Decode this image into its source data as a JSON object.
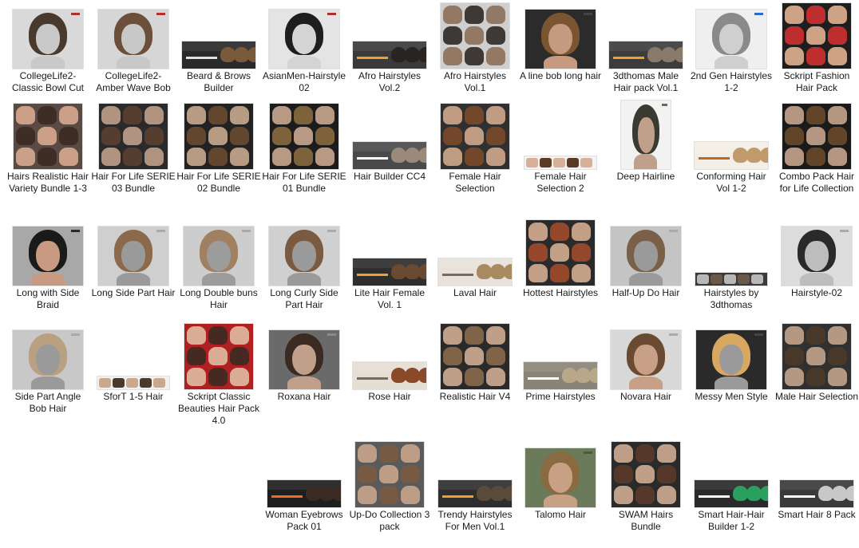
{
  "items": [
    {
      "label": "CollegeLife2-Classic Bowl Cut",
      "thumb": {
        "style": "portrait",
        "bg": "#d9d9d9",
        "hair": "#4a3a2e",
        "skin": "#c9c9c9",
        "accent": "#b03030"
      }
    },
    {
      "label": "CollegeLife2-Amber Wave Bob",
      "thumb": {
        "style": "portrait",
        "bg": "#d6d6d6",
        "hair": "#6b4f3a",
        "skin": "#c8c8c8",
        "accent": "#b03030"
      }
    },
    {
      "label": "Beard & Brows Builder",
      "thumb": {
        "style": "banner",
        "bg": "#2a2a2a",
        "hair": "#7a5a3a",
        "skin": "#b89478",
        "accent": "#e0e0e0"
      }
    },
    {
      "label": "AsianMen-Hairstyle 02",
      "thumb": {
        "style": "portrait",
        "bg": "#e4e4e4",
        "hair": "#1e1e1e",
        "skin": "#d4d4d4",
        "accent": "#b03030"
      }
    },
    {
      "label": "Afro Hairstyles Vol.2",
      "thumb": {
        "style": "banner",
        "bg": "#3a3a3a",
        "hair": "#2a2420",
        "skin": "#8a6a50",
        "accent": "#f0a030"
      }
    },
    {
      "label": "Afro Hairstyles Vol.1",
      "thumb": {
        "style": "grid",
        "bg": "#cfcfcf",
        "hair": "#2e2822",
        "skin": "#8c6e56",
        "accent": "#ffffff"
      }
    },
    {
      "label": "A line bob long hair",
      "thumb": {
        "style": "portrait",
        "bg": "#2b2b2b",
        "hair": "#7a5530",
        "skin": "#c49a80",
        "accent": "#444444"
      }
    },
    {
      "label": "3dthomas Male Hair pack Vol.1",
      "thumb": {
        "style": "banner",
        "bg": "#3c3c3c",
        "hair": "#8a7a6a",
        "skin": "#b0b0b0",
        "accent": "#f0a030"
      }
    },
    {
      "label": "2nd Gen Hairstyles 1-2",
      "thumb": {
        "style": "portrait",
        "bg": "#efefef",
        "hair": "#8a8a8a",
        "skin": "#cfcfcf",
        "accent": "#2a6ad0"
      }
    },
    {
      "label": "Sckript Fashion Hair Pack",
      "thumb": {
        "style": "grid",
        "bg": "#1e1e1e",
        "hair": "#d03030",
        "skin": "#e0b090",
        "accent": "#30a0e0"
      }
    },
    {
      "label": "Hairs Realistic Hair Variety Bundle 1-3",
      "thumb": {
        "style": "grid",
        "bg": "#5a4a44",
        "hair": "#3a2a22",
        "skin": "#d8a890",
        "accent": "#e04060"
      }
    },
    {
      "label": "Hair For Life SERIE 03 Bundle",
      "thumb": {
        "style": "grid",
        "bg": "#2a2a2a",
        "hair": "#5a4030",
        "skin": "#c0a08a",
        "accent": "#d03040"
      }
    },
    {
      "label": "Hair For Life SERIE 02 Bundle",
      "thumb": {
        "style": "grid",
        "bg": "#222222",
        "hair": "#6a4a30",
        "skin": "#c8a88e",
        "accent": "#d03040"
      }
    },
    {
      "label": "Hair For Life SERIE 01 Bundle",
      "thumb": {
        "style": "grid",
        "bg": "#1c1c1c",
        "hair": "#8a6a40",
        "skin": "#caa890",
        "accent": "#f0c040"
      }
    },
    {
      "label": "Hair Builder CC4",
      "thumb": {
        "style": "banner",
        "bg": "#4a4a4a",
        "hair": "#9a8a7a",
        "skin": "#bcbcbc",
        "accent": "#ffffff"
      }
    },
    {
      "label": "Female Hair Selection",
      "thumb": {
        "style": "grid",
        "bg": "#303030",
        "hair": "#7a4a2a",
        "skin": "#d0a88c",
        "accent": "#f0f0f0"
      }
    },
    {
      "label": "Female Hair Selection 2",
      "thumb": {
        "style": "strip",
        "bg": "#f4f4f4",
        "hair": "#5a3a22",
        "skin": "#d8b098",
        "accent": "#dddddd"
      }
    },
    {
      "label": "Deep Hairline",
      "thumb": {
        "style": "tall",
        "bg": "#f2f2f2",
        "hair": "#3a3a32",
        "skin": "#c0a08a",
        "accent": "#6a6a5a"
      }
    },
    {
      "label": "Conforming Hair Vol 1-2",
      "thumb": {
        "style": "banner",
        "bg": "#f4efe6",
        "hair": "#c09a6a",
        "skin": "#e0c4aa",
        "accent": "#b86a2a"
      }
    },
    {
      "label": "Combo Pack Hair for Life Collection",
      "thumb": {
        "style": "grid",
        "bg": "#1a1a1a",
        "hair": "#6a4a2a",
        "skin": "#c6a48c",
        "accent": "#f0c040"
      }
    },
    {
      "label": "Long with Side Braid",
      "thumb": {
        "style": "portrait",
        "bg": "#a8a8a8",
        "hair": "#1a1a1a",
        "skin": "#c89a82",
        "accent": "#2a2a2a"
      }
    },
    {
      "label": "Long Side Part Hair",
      "thumb": {
        "style": "portrait",
        "bg": "#cfcfcf",
        "hair": "#8a6a4a",
        "skin": "#9a9a9a",
        "accent": "#aaaaaa"
      }
    },
    {
      "label": "Long Double buns Hair",
      "thumb": {
        "style": "portrait",
        "bg": "#cdcdcd",
        "hair": "#a08060",
        "skin": "#9c9c9c",
        "accent": "#aaaaaa"
      }
    },
    {
      "label": "Long Curly Side Part Hair",
      "thumb": {
        "style": "portrait",
        "bg": "#d0d0d0",
        "hair": "#7a5a40",
        "skin": "#9a9a9a",
        "accent": "#aaaaaa"
      }
    },
    {
      "label": "Lite Hair Female Vol. 1",
      "thumb": {
        "style": "banner",
        "bg": "#2e2e2e",
        "hair": "#6a4a30",
        "skin": "#c8a890",
        "accent": "#f0a030"
      }
    },
    {
      "label": "Laval Hair",
      "thumb": {
        "style": "banner",
        "bg": "#e8e2da",
        "hair": "#a88a60",
        "skin": "#d8b8a0",
        "accent": "#7a6a5a"
      }
    },
    {
      "label": "Hottest Hairstyles",
      "thumb": {
        "style": "grid",
        "bg": "#2a2a2a",
        "hair": "#a04a2a",
        "skin": "#d4ac90",
        "accent": "#ffffff"
      }
    },
    {
      "label": "Half-Up Do Hair",
      "thumb": {
        "style": "portrait",
        "bg": "#c4c4c4",
        "hair": "#7a6048",
        "skin": "#9a9a9a",
        "accent": "#aaaaaa"
      }
    },
    {
      "label": "Hairstyles by 3dthomas",
      "thumb": {
        "style": "strip",
        "bg": "#3a3a3a",
        "hair": "#6a5a4a",
        "skin": "#b8b8b8",
        "accent": "#f0a030"
      }
    },
    {
      "label": "Hairstyle-02",
      "thumb": {
        "style": "portrait",
        "bg": "#dcdcdc",
        "hair": "#2a2a2a",
        "skin": "#bdbdbd",
        "accent": "#aaaaaa"
      }
    },
    {
      "label": "Side Part Angle Bob Hair",
      "thumb": {
        "style": "portrait",
        "bg": "#c8c8c8",
        "hair": "#b8a080",
        "skin": "#9a9a9a",
        "accent": "#aaaaaa"
      }
    },
    {
      "label": "SforT 1-5 Hair",
      "thumb": {
        "style": "strip",
        "bg": "#f0f0f0",
        "hair": "#4a3a2a",
        "skin": "#caa88e",
        "accent": "#3a6ad0"
      }
    },
    {
      "label": "Sckript Classic Beauties Hair Pack 4.0",
      "thumb": {
        "style": "grid",
        "bg": "#b02020",
        "hair": "#3a2a22",
        "skin": "#e0bca4",
        "accent": "#ffffff"
      }
    },
    {
      "label": "Roxana Hair",
      "thumb": {
        "style": "portrait",
        "bg": "#6a6a6a",
        "hair": "#3a2a22",
        "skin": "#c0a08a",
        "accent": "#8a8a8a"
      }
    },
    {
      "label": "Rose Hair",
      "thumb": {
        "style": "banner",
        "bg": "#e6ded4",
        "hair": "#8a4a2a",
        "skin": "#d8b49c",
        "accent": "#7a6a5a"
      }
    },
    {
      "label": "Realistic Hair V4",
      "thumb": {
        "style": "grid",
        "bg": "#2a2a2a",
        "hair": "#8a6a4a",
        "skin": "#d0ac94",
        "accent": "#ffffff"
      }
    },
    {
      "label": "Prime Hairstyles",
      "thumb": {
        "style": "banner",
        "bg": "#8a8478",
        "hair": "#b8a888",
        "skin": "#ccb8a4",
        "accent": "#ffffff"
      }
    },
    {
      "label": "Novara Hair",
      "thumb": {
        "style": "portrait",
        "bg": "#d8d8d8",
        "hair": "#6a4a30",
        "skin": "#c8a088",
        "accent": "#aaaaaa"
      }
    },
    {
      "label": "Messy Men Style",
      "thumb": {
        "style": "portrait",
        "bg": "#2a2a2a",
        "hair": "#d8a860",
        "skin": "#9a9a9a",
        "accent": "#444444"
      }
    },
    {
      "label": "Male Hair Selection",
      "thumb": {
        "style": "grid",
        "bg": "#303030",
        "hair": "#4a3a2a",
        "skin": "#c4a48c",
        "accent": "#ffffff"
      }
    },
    {
      "label": "Woman Eyebrows Pack 01",
      "thumb": {
        "style": "banner",
        "bg": "#1e1e1e",
        "hair": "#3a2a22",
        "skin": "#d8b49c",
        "accent": "#f06a20"
      }
    },
    {
      "label": "Up-Do Collection 3 pack",
      "thumb": {
        "style": "grid",
        "bg": "#5a5a5a",
        "hair": "#7a5a40",
        "skin": "#c8a48a",
        "accent": "#f0a030"
      }
    },
    {
      "label": "Trendy Hairstyles For Men Vol.1",
      "thumb": {
        "style": "banner",
        "bg": "#2e2e2e",
        "hair": "#5a4a3a",
        "skin": "#b8b8b8",
        "accent": "#f0a030"
      }
    },
    {
      "label": "Talomo Hair",
      "thumb": {
        "style": "portrait",
        "bg": "#6a7a5a",
        "hair": "#8a6a40",
        "skin": "#c8a084",
        "accent": "#4a5a3a"
      }
    },
    {
      "label": "SWAM Hairs Bundle",
      "thumb": {
        "style": "grid",
        "bg": "#2a2a2a",
        "hair": "#5a3a2a",
        "skin": "#d0ac94",
        "accent": "#ffffff"
      }
    },
    {
      "label": "Smart Hair-Hair Builder 1-2",
      "thumb": {
        "style": "banner",
        "bg": "#2a2a2a",
        "hair": "#2aa060",
        "skin": "#d4b098",
        "accent": "#ffffff"
      }
    },
    {
      "label": "Smart Hair 8 Pack",
      "thumb": {
        "style": "banner",
        "bg": "#3a3a3a",
        "hair": "#c8c8c8",
        "skin": "#a8a8a8",
        "accent": "#ffffff"
      }
    }
  ]
}
